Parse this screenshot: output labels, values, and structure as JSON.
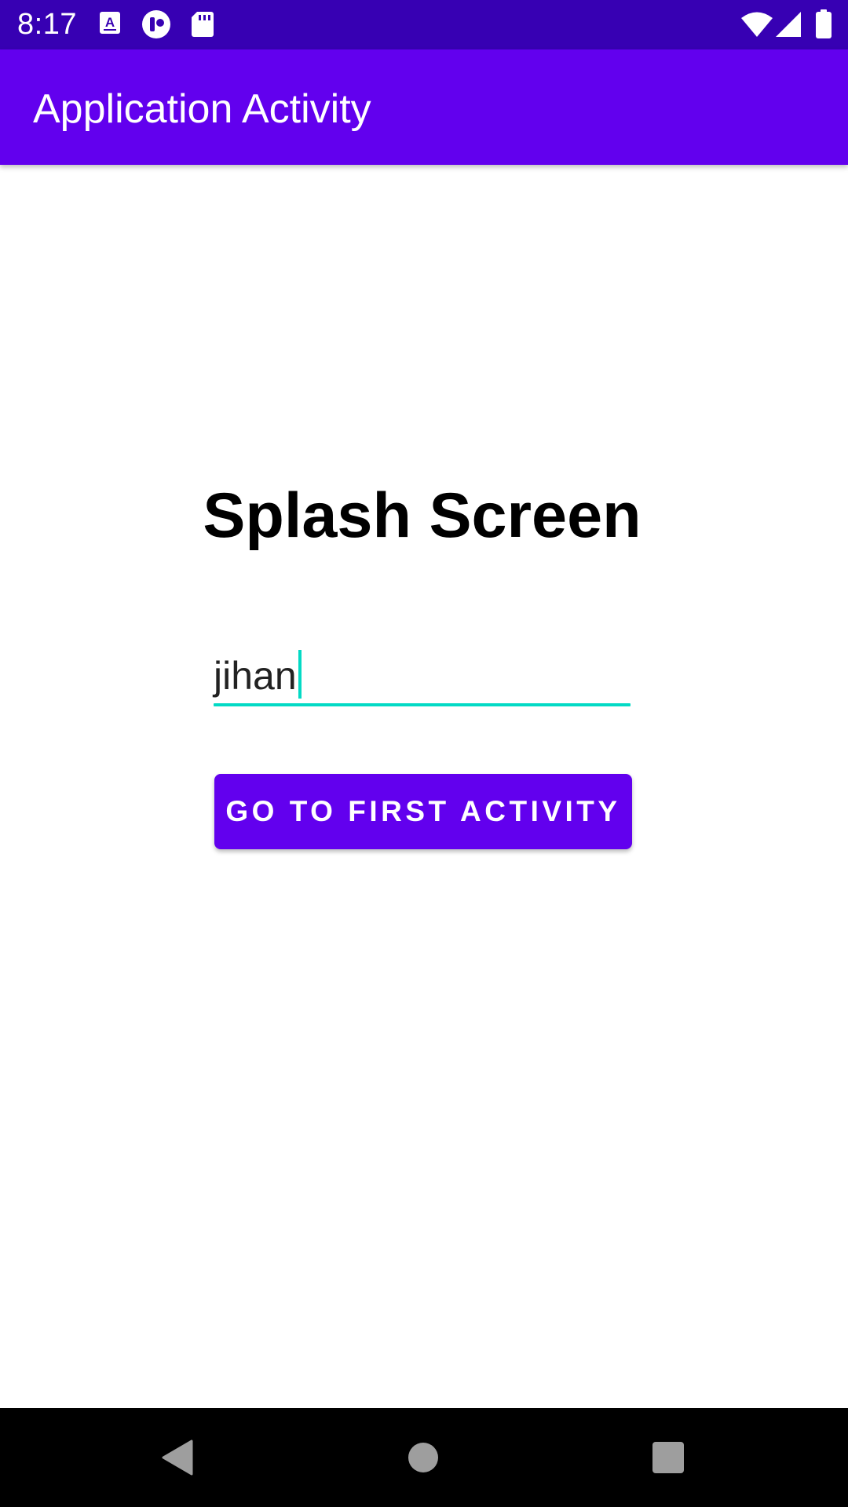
{
  "status_bar": {
    "time": "8:17",
    "left_icons": [
      "text-a-notification-icon",
      "app-notification-icon",
      "sd-card-icon"
    ],
    "right_icons": [
      "wifi-icon",
      "cell-signal-icon",
      "battery-icon"
    ]
  },
  "app_bar": {
    "title": "Application Activity"
  },
  "main": {
    "heading": "Splash Screen",
    "name_input": {
      "value": "jihan"
    },
    "go_button_label": "GO TO FIRST ACTIVITY"
  },
  "nav_bar": {
    "buttons": [
      "back-icon",
      "home-icon",
      "recents-icon"
    ]
  },
  "colors": {
    "status_bar": "#3700b3",
    "primary": "#6200ee",
    "accent": "#03dac5",
    "background": "#ffffff"
  }
}
